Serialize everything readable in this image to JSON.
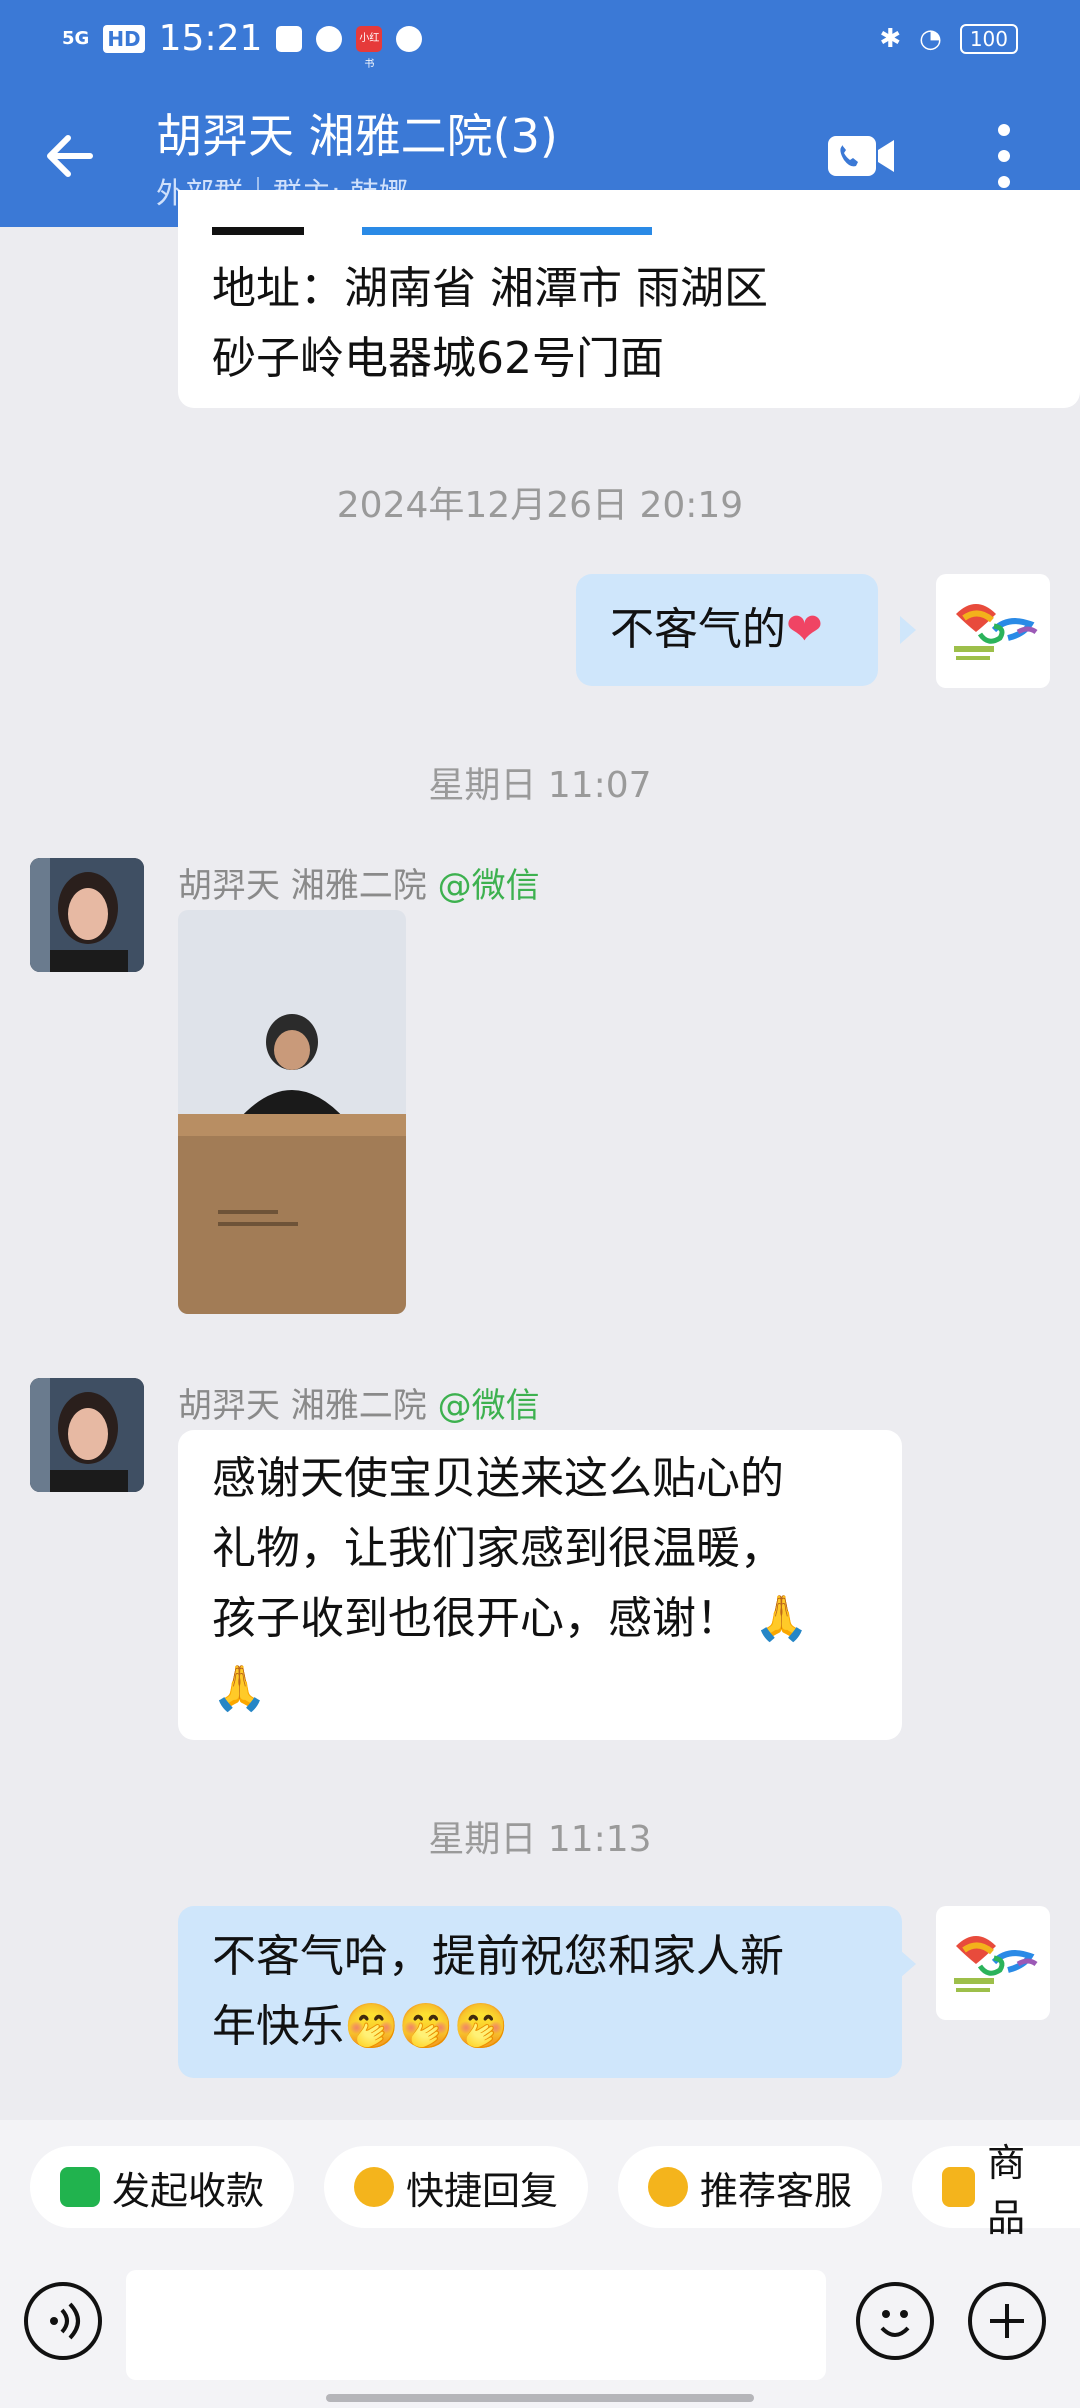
{
  "status_bar": {
    "network": "5G",
    "hd": "HD",
    "time": "15:21",
    "app_badge": "小红书",
    "battery": "100"
  },
  "header": {
    "title": "胡羿天  湘雅二院(3)",
    "group_type": "外部群",
    "owner": "群主: 韩娜"
  },
  "messages": {
    "m1_line1": "地址：湖南省 湘潭市 雨湖区",
    "m1_line2": "砂子岭电器城62号门面",
    "t1": "2024年12月26日  20:19",
    "m2_text": "不客气的",
    "m2_emoji": "❤",
    "t2": "星期日  11:07",
    "m3_sender": "胡羿天  湘雅二院",
    "m3_tag": "@微信",
    "m4_sender": "胡羿天  湘雅二院",
    "m4_tag": "@微信",
    "m4_line1": "感谢天使宝贝送来这么贴心的",
    "m4_line2": "礼物，让我们家感到很温暖，",
    "m4_line3": "孩子收到也很开心，感谢！",
    "m4_emoji": "🙏",
    "t3": "星期日  11:13",
    "m5_line1": "不客气哈，提前祝您和家人新",
    "m5_line2": "年快乐",
    "m5_emoji": "🤭🤭🤭"
  },
  "quick_actions": [
    "发起收款",
    "快捷回复",
    "推荐客服",
    "商品"
  ],
  "colors": {
    "header": "#3b79d6",
    "bubble_self": "#cfe6fb",
    "wechat_green": "#3db14f"
  },
  "icons": {
    "back": "arrow-left-icon",
    "video": "video-call-icon",
    "more": "more-vertical-icon",
    "voice": "voice-icon",
    "emoji": "emoji-icon",
    "plus": "plus-icon"
  }
}
